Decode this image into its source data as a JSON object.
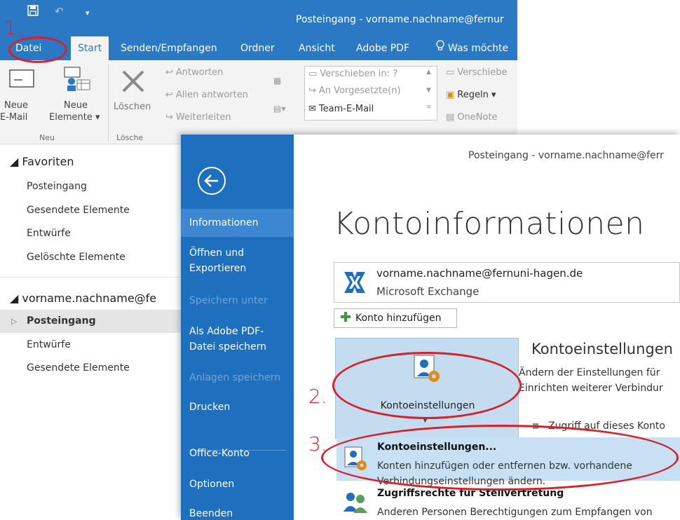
{
  "window": {
    "title": "Posteingang - vorname.nachname@fernur"
  },
  "ribbon_tabs": [
    "Datei",
    "Start",
    "Senden/Empfangen",
    "Ordner",
    "Ansicht",
    "Adobe PDF",
    "Was möchte"
  ],
  "ribbon": {
    "new_email": [
      "Neue",
      "E-Mail"
    ],
    "new_items": [
      "Neue",
      "Elemente ▾"
    ],
    "delete": "Löschen",
    "reply": "Antworten",
    "reply_all": "Allen antworten",
    "forward": "Weiterleiten",
    "move_to": "Verschieben in: ?",
    "to_manager": "An Vorgesetzte(n)",
    "team_email": "Team-E-Mail",
    "move": "Verschiebe",
    "rules": "Regeln ▾",
    "onenote": "OneNote",
    "group_new": "Neu",
    "group_delete": "Lösche"
  },
  "folder_pane": {
    "favorites_header": "◢ Favoriten",
    "favorites": [
      "Posteingang",
      "Gesendete Elemente",
      "Entwürfe",
      "Gelöschte Elemente"
    ],
    "account_header": "◢ vorname.nachname@fe",
    "account_folders": [
      "Posteingang",
      "Entwürfe",
      "Gesendete Elemente"
    ],
    "selected_marker": "▷"
  },
  "backstage": {
    "title": "Posteingang - vorname.nachname@ferr",
    "nav": {
      "info": "Informationen",
      "open_export": [
        "Öffnen und",
        "Exportieren"
      ],
      "save_as": "Speichern unter",
      "save_pdf": [
        "Als Adobe PDF-",
        "Datei speichern"
      ],
      "save_attachments": "Anlagen speichern",
      "print": "Drucken",
      "office_account": "Office-Konto",
      "options": "Optionen",
      "exit": "Beenden"
    },
    "heading": "Kontoinformationen",
    "account_email": "vorname.nachname@fernuni-hagen.de",
    "account_type": "Microsoft Exchange",
    "add_account": "Konto hinzufügen",
    "account_settings_button": "Kontoeinstellungen",
    "account_settings_heading": "Kontoeinstellungen",
    "account_settings_desc": [
      "Ändern der Einstellungen für",
      "Einrichten weiterer Verbindur"
    ],
    "account_settings_bullet": "Zugriff auf dieses Konto",
    "dropdown": [
      {
        "title": "Kontoeinstellungen...",
        "desc": [
          "Konten hinzufügen oder entfernen bzw. vorhandene",
          "Verbindungseinstellungen ändern."
        ]
      },
      {
        "title": "Zugriffsrechte für Stellvertretung",
        "desc": [
          "Anderen Personen Berechtigungen zum Empfangen von",
          ""
        ]
      }
    ]
  },
  "annotations": {
    "step1": "1.",
    "step2": "2.",
    "step3": "3."
  },
  "colors": {
    "outlook_blue": "#2b78c5",
    "backstage_nav": "#1f6fbf",
    "annotation_red": "#d8202a",
    "highlight": "#c8e0f4"
  }
}
